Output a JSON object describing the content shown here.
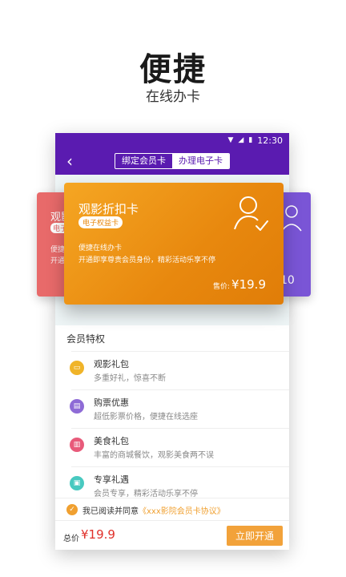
{
  "promo": {
    "headline": "便捷",
    "subheadline": "在线办卡"
  },
  "status_bar": {
    "time": "12:30"
  },
  "app_bar": {
    "tabs": [
      {
        "label": "绑定会员卡",
        "active": false
      },
      {
        "label": "办理电子卡",
        "active": true
      }
    ]
  },
  "cards": {
    "left": {
      "title": "观影",
      "tag": "电子",
      "line1": "便捷",
      "line2": "开通"
    },
    "main": {
      "title": "观影折扣卡",
      "tag": "电子权益卡",
      "line1": "便捷在线办卡",
      "line2": "开通即享尊贵会员身份，精彩活动乐享不停",
      "price_label": "售价:",
      "price": "¥19.9"
    },
    "right": {
      "price": "10"
    }
  },
  "benefits": {
    "header": "会员特权",
    "items": [
      {
        "title": "观影礼包",
        "desc": "多重好礼，惊喜不断",
        "color": "#f0b429",
        "icon": "ticket-icon"
      },
      {
        "title": "购票优惠",
        "desc": "超低影票价格，便捷在线选座",
        "color": "#8e6bd6",
        "icon": "coupon-icon"
      },
      {
        "title": "美食礼包",
        "desc": "丰富的商城餐饮，观影美食两不误",
        "color": "#e85a7a",
        "icon": "food-icon"
      },
      {
        "title": "专享礼遇",
        "desc": "会员专享，精彩活动乐享不停",
        "color": "#48c9c0",
        "icon": "gift-icon"
      }
    ]
  },
  "agreement": {
    "text": "我已阅读并同意",
    "link": "《xxx影院会员卡协议》"
  },
  "footer": {
    "total_label": "总价",
    "total_value": "¥19.9",
    "submit_label": "立即开通"
  },
  "colors": {
    "brand": "#5a1bb0",
    "accent": "#f2a23a",
    "price": "#e0302a"
  }
}
